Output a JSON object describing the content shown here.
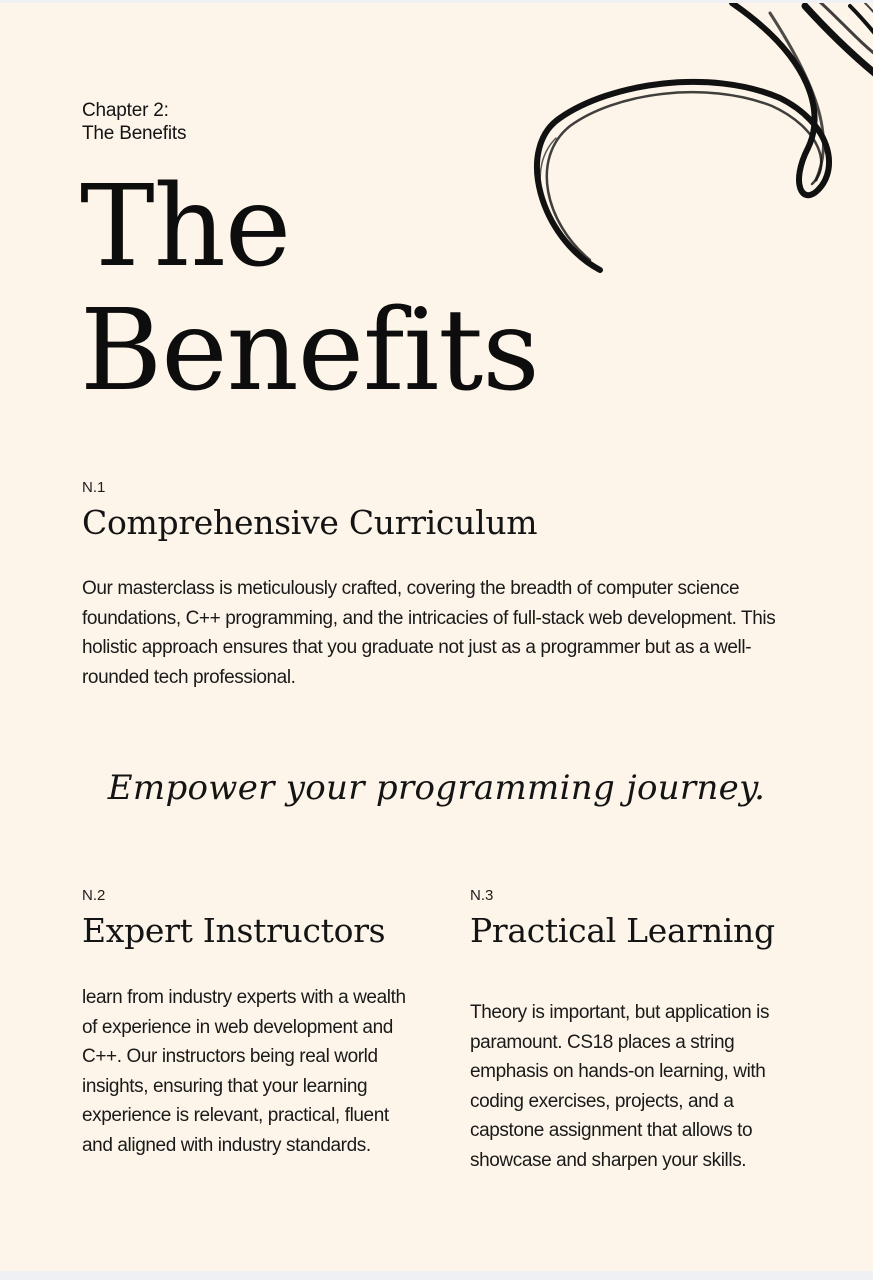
{
  "chapter": {
    "line1": "Chapter 2:",
    "line2": "The Benefits"
  },
  "title": {
    "line1": "The",
    "line2": "Benefits"
  },
  "benefit1": {
    "number": "N.1",
    "heading": "Comprehensive Curriculum",
    "body": "Our masterclass is meticulously crafted, covering the breadth of computer science foundations, C++ programming, and the intricacies of full-stack web development. This holistic approach ensures that you graduate not just as a programmer but as a well-rounded tech professional."
  },
  "tagline": "Empower your programming journey.",
  "benefit2": {
    "number": "N.2",
    "heading": "Expert Instructors",
    "body": "learn from industry experts with a wealth of experience in web development and C++. Our instructors being real world insights, ensuring that your learning experience is relevant, practical, fluent and aligned with industry standards."
  },
  "benefit3": {
    "number": "N.3",
    "heading": "Practical Learning",
    "body": "Theory is important, but application is paramount.  CS18 places a string emphasis on hands-on learning, with coding exercises, projects, and a capstone assignment that allows to showcase and sharpen your skills."
  },
  "colors": {
    "page_background": "#fdf5e9",
    "text": "#141414",
    "outer_background": "#eef0f4"
  }
}
